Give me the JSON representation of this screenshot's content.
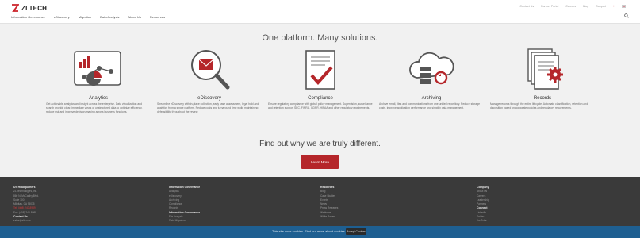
{
  "header": {
    "logo_text": "ZLTECH",
    "utility_links": [
      "Contact Us",
      "Partner Portal",
      "Careers",
      "Blog",
      "Support"
    ],
    "nav_items": [
      "Information Governance",
      "eDiscovery",
      "Migration",
      "Data Analysis",
      "About Us",
      "Resources"
    ]
  },
  "main": {
    "headline": "One platform. Many solutions.",
    "solutions": [
      {
        "title": "Analytics",
        "desc": "Get actionable analytics and insight across the enterprise. Data visualization and search provide clear, immediate views of unstructured data to optimize efficiency, reduce risk and improve decision-making across business functions."
      },
      {
        "title": "eDiscovery",
        "desc": "Streamline eDiscovery with in-place collection, early case assessment, legal hold and analytics from a single platform. Reduce costs and turnaround time while maintaining defensibility throughout the review."
      },
      {
        "title": "Compliance",
        "desc": "Ensure regulatory compliance with global policy management. Supervision, surveillance and retention support SEC, FINRA, GDPR, HIPAA and other regulatory requirements."
      },
      {
        "title": "Archiving",
        "desc": "Archive email, files and communications from one unified repository. Reduce storage costs, improve application performance and simplify data management."
      },
      {
        "title": "Records",
        "desc": "Manage records through the entire lifecycle. Automate classification, retention and disposition based on corporate policies and regulatory requirements."
      }
    ],
    "cta_title": "Find out why we are truly different.",
    "cta_button": "Learn More"
  },
  "footer": {
    "columns": [
      {
        "heading": "US Headquarters",
        "lines": [
          "ZL Technologies, Inc.",
          "860 N. McCarthy Blvd.",
          "Suite 100",
          "Milpitas, CA 95035",
          "Tel: (408) 240-8989",
          "Fax: (408) 240-8988"
        ],
        "extra_heading": "Contact Us",
        "extra_lines": [
          "sales@zlti.com"
        ]
      },
      {
        "heading": "Information Governance",
        "lines": [
          "Analytics",
          "eDiscovery",
          "Archiving",
          "Compliance",
          "Records"
        ],
        "extra_heading": "Information Governance",
        "extra_lines": [
          "File Analysis",
          "Data Migration"
        ]
      },
      {
        "heading": "Resources",
        "lines": [
          "Blog",
          "Case Studies",
          "Events",
          "News",
          "Press Releases",
          "Webinars",
          "White Papers"
        ],
        "extra_heading": "",
        "extra_lines": []
      },
      {
        "heading": "Company",
        "lines": [
          "About Us",
          "Careers",
          "Leadership",
          "Partners"
        ],
        "extra_heading": "Connect",
        "extra_lines": [
          "LinkedIn",
          "Twitter",
          "YouTube"
        ]
      }
    ]
  },
  "cookie": {
    "text": "This site uses cookies. Find out more about cookies.",
    "button": "Accept Cookies"
  },
  "colors": {
    "accent": "#b5262a",
    "footer_bg": "#3a3a3a",
    "cookie_bg": "#1e5f91"
  }
}
